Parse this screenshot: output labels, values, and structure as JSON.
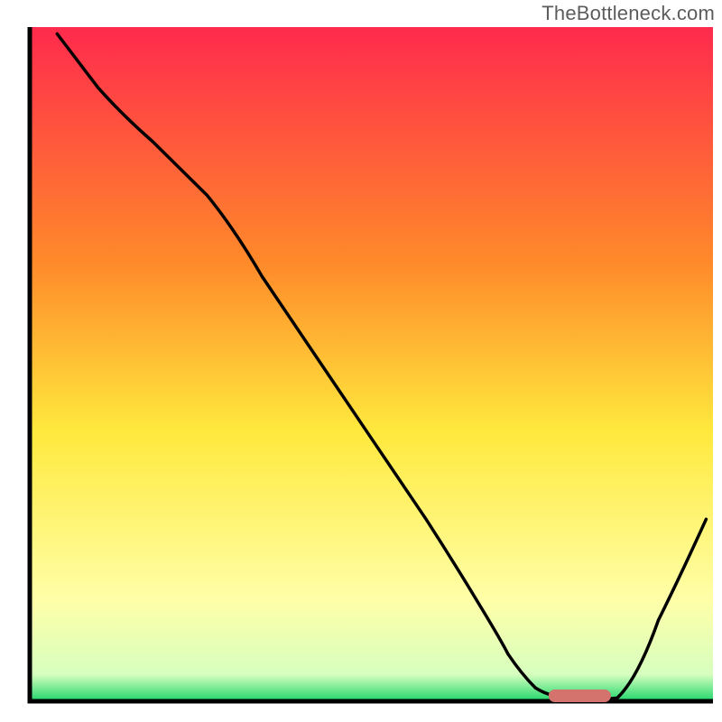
{
  "watermark": "TheBottleneck.com",
  "colors": {
    "top": "#ff2a4d",
    "orange": "#ff8a2a",
    "yellow_mid": "#ffe93d",
    "pale_yellow": "#ffffa8",
    "bottom_green": "#1fd66b",
    "axis": "#000000",
    "curve": "#000000",
    "marker_fill": "#d4726e",
    "marker_stroke": "#d4726e"
  },
  "chart_data": {
    "type": "line",
    "title": "",
    "xlabel": "",
    "ylabel": "",
    "xlim": [
      0,
      100
    ],
    "ylim": [
      0,
      100
    ],
    "note": "Axes have no visible ticks or numeric labels. Curve values are relative percentages estimated from the rendered plot.",
    "series": [
      {
        "name": "bottleneck-curve",
        "x": [
          4,
          10,
          18,
          26,
          34,
          42,
          50,
          58,
          66,
          70,
          74,
          80,
          86,
          92,
          99
        ],
        "y": [
          99,
          91,
          83,
          75,
          63,
          51,
          39,
          27,
          14,
          7,
          2,
          0.5,
          0.5,
          12,
          27
        ]
      }
    ],
    "marker": {
      "name": "optimal-range",
      "x_start": 76,
      "x_end": 85,
      "y": 0.8
    },
    "gradient_bands_approx": [
      {
        "pct_from_top": 0,
        "color": "#ff2a4d"
      },
      {
        "pct_from_top": 35,
        "color": "#ff8a2a"
      },
      {
        "pct_from_top": 60,
        "color": "#ffe93d"
      },
      {
        "pct_from_top": 85,
        "color": "#ffffa8"
      },
      {
        "pct_from_top": 100,
        "color": "#1fd66b"
      }
    ]
  }
}
